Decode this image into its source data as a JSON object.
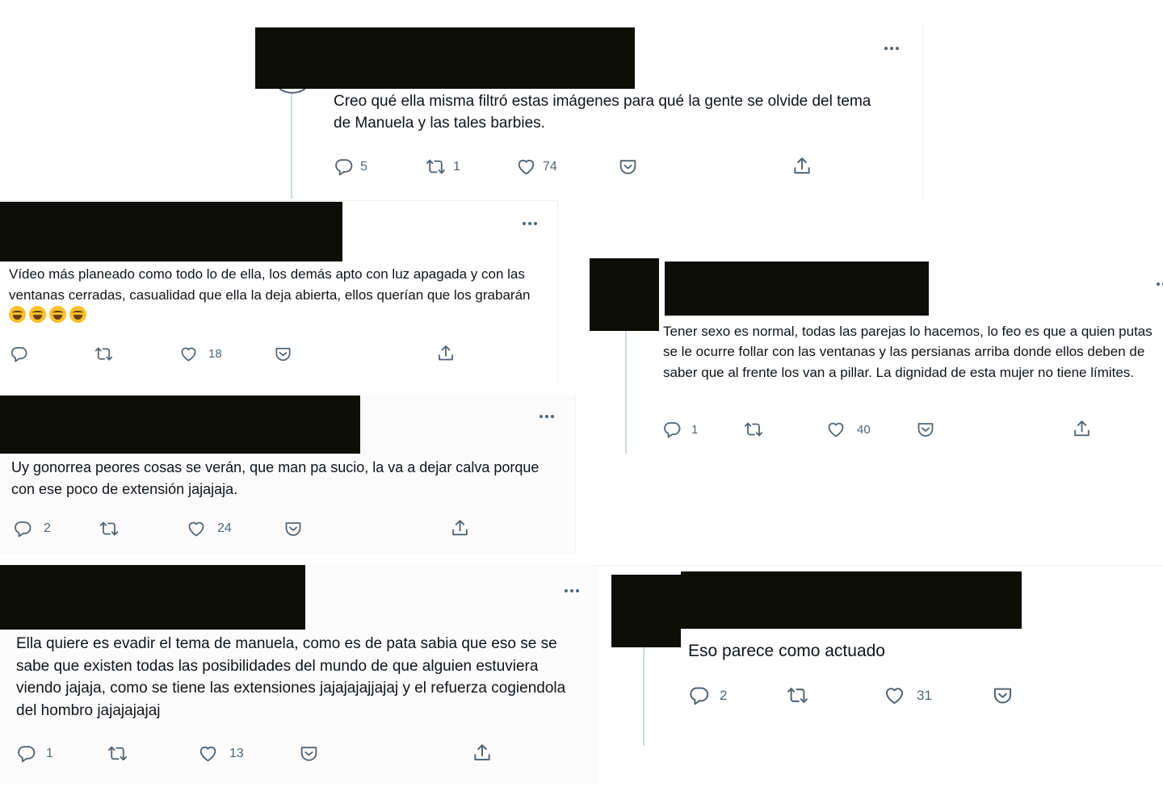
{
  "tweets": [
    {
      "text": "Creo qué ella misma filtró estas imágenes para qué la gente se olvide del tema de Manuela y las tales barbies.",
      "replies": "5",
      "retweets": "1",
      "likes": "74"
    },
    {
      "text": "Vídeo más planeado como todo lo de ella, los demás apto con luz apagada y con las ventanas cerradas, casualidad que ella la deja abierta, ellos querían que los grabarán",
      "emoji_count": 4,
      "replies": "",
      "retweets": "",
      "likes": "18"
    },
    {
      "text": "Uy gonorrea peores cosas se verán, que man pa sucio, la va a dejar calva porque con ese poco de extensión jajajaja.",
      "replies": "2",
      "retweets": "",
      "likes": "24"
    },
    {
      "text": "Ella quiere es evadir el tema de manuela,  como es de pata sabia que eso se se sabe que existen todas las posibilidades del mundo de que alguien estuviera viendo jajaja, como se tiene las extensiones jajajajajjajaj y el refuerza cogiendola del hombro jajajajajaj",
      "replies": "1",
      "retweets": "",
      "likes": "13"
    },
    {
      "text": "Tener sexo es normal, todas las parejas lo hacemos, lo feo es que a quien putas se le ocurre follar con las ventanas y las persianas arriba donde ellos deben de saber que al frente los van a pillar. La dignidad de esta mujer no tiene límites.",
      "replies": "1",
      "retweets": "",
      "likes": "40"
    },
    {
      "text": "Eso parece como actuado",
      "replies": "2",
      "retweets": "",
      "likes": "31"
    }
  ],
  "icons": {
    "reply": "reply-icon",
    "retweet": "retweet-icon",
    "like": "heart-icon",
    "save": "bookmark-pocket-icon",
    "share": "share-icon",
    "more": "more-icon"
  },
  "colors": {
    "icon": "#536471",
    "text": "#0f1419",
    "redaction": "#0e0e09",
    "thread_line": "#cfd9de"
  }
}
